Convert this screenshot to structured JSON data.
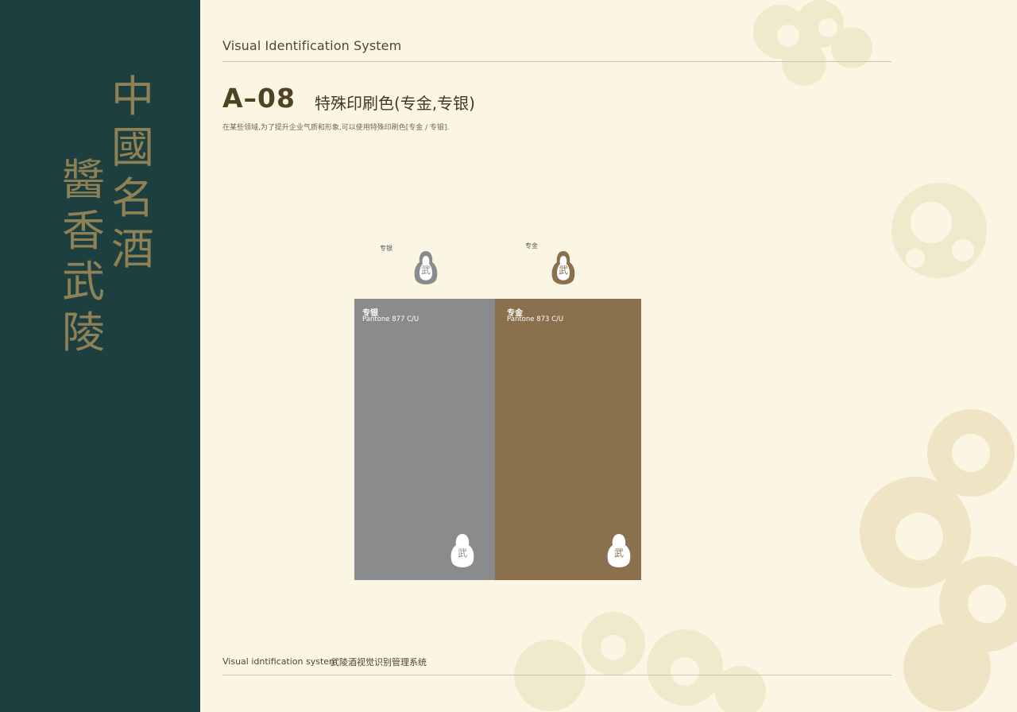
{
  "sidebar": {
    "column_right": [
      "中",
      "國",
      "名",
      "酒"
    ],
    "column_left": [
      "醬",
      "香",
      "武",
      "陵"
    ]
  },
  "header": {
    "title": "Visual Identification System"
  },
  "section": {
    "code": "A–08",
    "title": "特殊印刷色(专金,专银)",
    "description": "在某些领域,为了提升企业气质和形象,可以使用特殊印刷色[专金 / 专银]."
  },
  "logos": {
    "silver_label": "专银",
    "gold_label": "专金",
    "emblem_char": "武"
  },
  "swatches": [
    {
      "name": "专银",
      "pantone": "Pantone 877 C/U",
      "color": "#898b8c"
    },
    {
      "name": "专金",
      "pantone": "Pantone 873 C/U",
      "color": "#8a704c"
    }
  ],
  "colors": {
    "sidebar": "#1e3f40",
    "background": "#fbf6e3",
    "sidebar_text": "#8d8155",
    "silver": "#898b8c",
    "gold": "#8a704c"
  },
  "footer": {
    "en": "Visual idntification system",
    "cn": "武陵酒视觉识别管理系统"
  }
}
